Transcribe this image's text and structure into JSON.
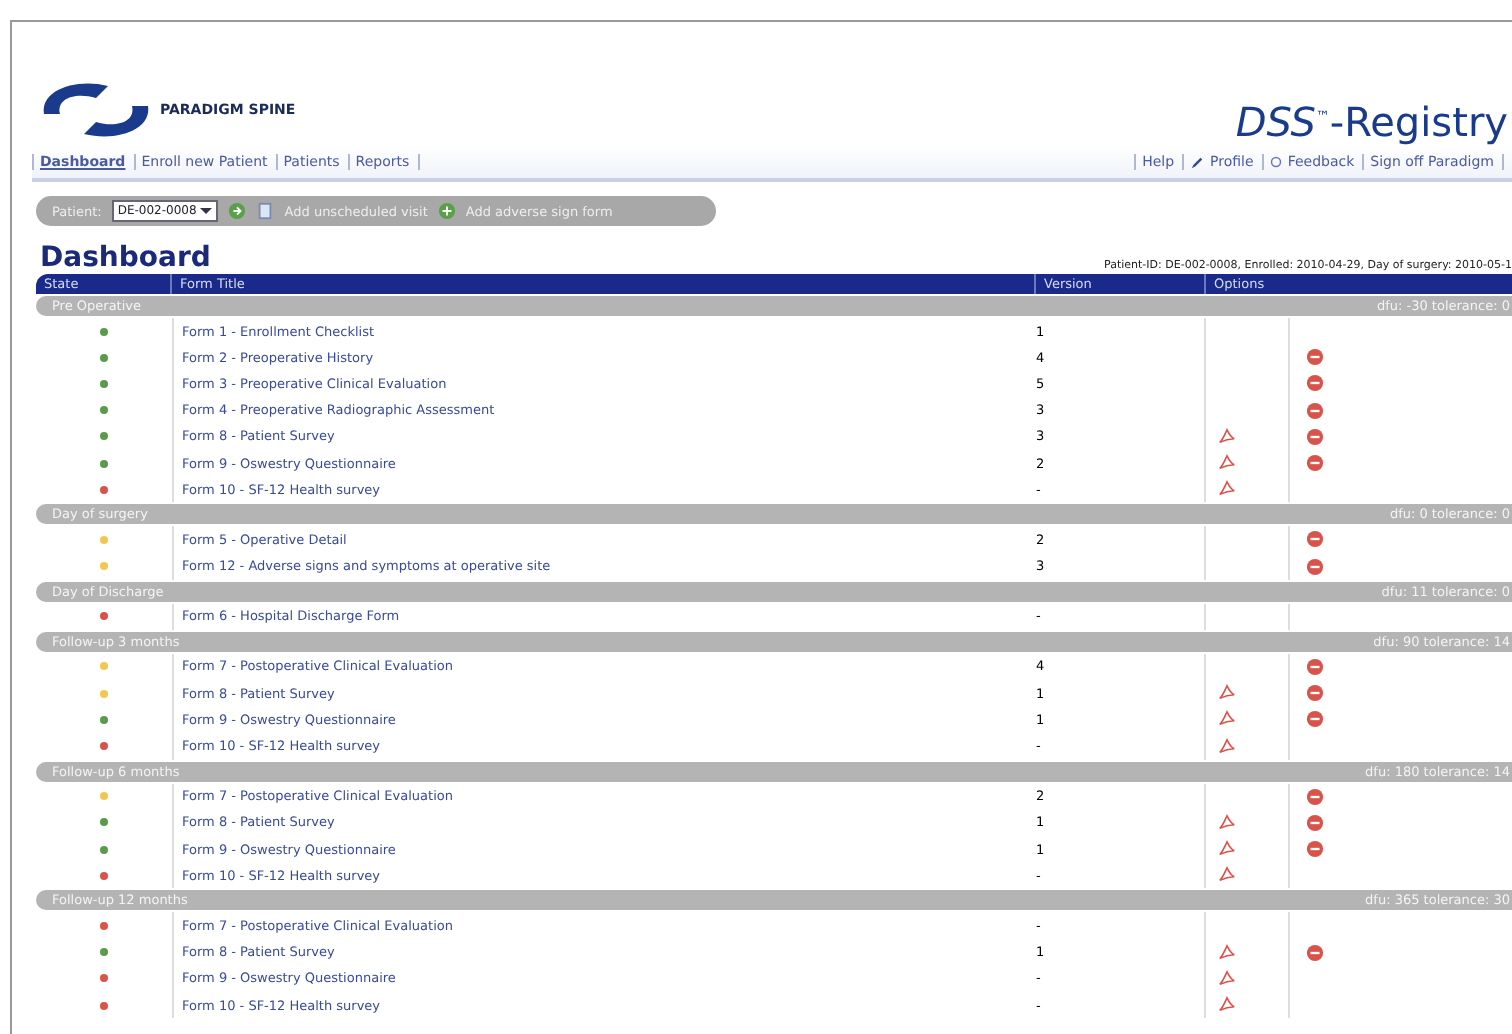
{
  "brand": {
    "name": "PARADIGM SPINE",
    "product": "DSS",
    "trademark": "™",
    "product_suffix": "-Registry"
  },
  "nav": [
    {
      "label": "Dashboard",
      "selected": true
    },
    {
      "label": "Enroll new Patient",
      "selected": false
    },
    {
      "label": "Patients",
      "selected": false
    },
    {
      "label": "Reports",
      "selected": false
    }
  ],
  "user_links": [
    {
      "label": "Help",
      "kind": "plain"
    },
    {
      "label": "Profile",
      "kind": "pencil"
    },
    {
      "label": "Feedback",
      "kind": "circle"
    },
    {
      "label": "Sign off Paradigm",
      "kind": "plain"
    }
  ],
  "toolbar": {
    "patient_label": "Patient:",
    "patient_value": "DE-002-0008",
    "actions": [
      {
        "label": "Add unscheduled visit",
        "kind": "page"
      },
      {
        "label": "Add adverse sign form",
        "kind": "plus"
      }
    ]
  },
  "title": "Dashboard",
  "patient_info": "Patient-ID: DE-002-0008, Enrolled: 2010-04-29, Day of surgery: 2010-05-1",
  "table": {
    "columns": [
      "State",
      "Form Title",
      "Version",
      "Options"
    ],
    "groups": [
      {
        "title": "Pre Operative",
        "info": "dfu: -30 tolerance: 0",
        "rows": [
          {
            "color": "#5a9a4a",
            "title": "Form 1 - Enrollment Checklist",
            "version": "1",
            "pdf": false,
            "alert": false
          },
          {
            "color": "#5a9a4a",
            "title": "Form 2 - Preoperative History",
            "version": "4",
            "pdf": false,
            "alert": true
          },
          {
            "color": "#5a9a4a",
            "title": "Form 3 - Preoperative Clinical Evaluation",
            "version": "5",
            "pdf": false,
            "alert": true
          },
          {
            "color": "#5a9a4a",
            "title": "Form 4 - Preoperative Radiographic Assessment",
            "version": "3",
            "pdf": false,
            "alert": true
          },
          {
            "color": "#5a9a4a",
            "title": "Form 8 - Patient Survey",
            "version": "3",
            "pdf": true,
            "alert": true
          },
          {
            "color": "#5a9a4a",
            "title": "Form 9 - Oswestry Questionnaire",
            "version": "2",
            "pdf": true,
            "alert": true
          },
          {
            "color": "#d9534a",
            "title": "Form 10 - SF-12 Health survey",
            "version": "-",
            "pdf": true,
            "alert": false
          }
        ]
      },
      {
        "title": "Day of surgery",
        "info": "dfu: 0 tolerance: 0",
        "rows": [
          {
            "color": "#f0c850",
            "title": "Form 5 - Operative Detail",
            "version": "2",
            "pdf": false,
            "alert": true
          },
          {
            "color": "#f0c850",
            "title": "Form 12 - Adverse signs and symptoms at operative site",
            "version": "3",
            "pdf": false,
            "alert": true
          }
        ]
      },
      {
        "title": "Day of Discharge",
        "info": "dfu: 11 tolerance: 0",
        "rows": [
          {
            "color": "#d9534a",
            "title": "Form 6 - Hospital Discharge Form",
            "version": "-",
            "pdf": false,
            "alert": false
          }
        ]
      },
      {
        "title": "Follow-up 3 months",
        "info": "dfu: 90 tolerance: 14",
        "rows": [
          {
            "color": "#f0c850",
            "title": "Form 7 - Postoperative Clinical Evaluation",
            "version": "4",
            "pdf": false,
            "alert": true
          },
          {
            "color": "#f0c850",
            "title": "Form 8 - Patient Survey",
            "version": "1",
            "pdf": true,
            "alert": true
          },
          {
            "color": "#5a9a4a",
            "title": "Form 9 - Oswestry Questionnaire",
            "version": "1",
            "pdf": true,
            "alert": true
          },
          {
            "color": "#d9534a",
            "title": "Form 10 - SF-12 Health survey",
            "version": "-",
            "pdf": true,
            "alert": false
          }
        ]
      },
      {
        "title": "Follow-up 6 months",
        "info": "dfu: 180 tolerance: 14",
        "rows": [
          {
            "color": "#f0c850",
            "title": "Form 7 - Postoperative Clinical Evaluation",
            "version": "2",
            "pdf": false,
            "alert": true
          },
          {
            "color": "#5a9a4a",
            "title": "Form 8 - Patient Survey",
            "version": "1",
            "pdf": true,
            "alert": true
          },
          {
            "color": "#5a9a4a",
            "title": "Form 9 - Oswestry Questionnaire",
            "version": "1",
            "pdf": true,
            "alert": true
          },
          {
            "color": "#d9534a",
            "title": "Form 10 - SF-12 Health survey",
            "version": "-",
            "pdf": true,
            "alert": false
          }
        ]
      },
      {
        "title": "Follow-up 12 months",
        "info": "dfu: 365 tolerance: 30",
        "rows": [
          {
            "color": "#d9534a",
            "title": "Form 7 - Postoperative Clinical Evaluation",
            "version": "-",
            "pdf": false,
            "alert": false
          },
          {
            "color": "#5a9a4a",
            "title": "Form 8 - Patient Survey",
            "version": "1",
            "pdf": true,
            "alert": true
          },
          {
            "color": "#d9534a",
            "title": "Form 9 - Oswestry Questionnaire",
            "version": "-",
            "pdf": true,
            "alert": false
          },
          {
            "color": "#d9534a",
            "title": "Form 10 - SF-12 Health survey",
            "version": "-",
            "pdf": true,
            "alert": false
          }
        ]
      }
    ]
  }
}
